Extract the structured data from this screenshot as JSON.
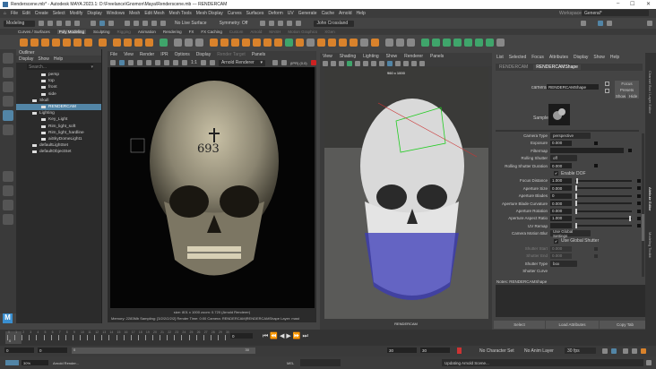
{
  "window": {
    "title": "Renderscene.mb* - Autodesk MAYA 2023.1: D:\\Freelance\\Gnomon\\Maya\\Renderscene.mb  ---  RENDERCAM",
    "minimize": "–",
    "maximize": "☐",
    "close": "✕"
  },
  "menubar": [
    "File",
    "Edit",
    "Create",
    "Select",
    "Modify",
    "Display",
    "Windows",
    "Mesh",
    "Edit Mesh",
    "Mesh Tools",
    "Mesh Display",
    "Curves",
    "Surfaces",
    "Deform",
    "UV",
    "Generate",
    "Cache",
    "Arnold",
    "Help"
  ],
  "workspace": {
    "label": "Workspace:",
    "value": "General*"
  },
  "statusline": {
    "mode": "Modeling",
    "live_surface": "No Live Surface",
    "symmetry": "Symmetry: Off",
    "user": "John Crossland"
  },
  "shelf_tabs": [
    "Curves / Surfaces",
    "Poly Modeling",
    "Sculpting",
    "Rigging",
    "Animation",
    "Rendering",
    "FX",
    "FX Caching",
    "Custom",
    "Arnold",
    "MASH",
    "Motion Graphics",
    "XGen"
  ],
  "shelf_active": "Poly Modeling",
  "outliner": {
    "title": "Outliner",
    "menu": [
      "Display",
      "Show",
      "Help"
    ],
    "search_placeholder": "Search...",
    "items": [
      {
        "label": "persp",
        "indent": 2
      },
      {
        "label": "top",
        "indent": 2
      },
      {
        "label": "front",
        "indent": 2
      },
      {
        "label": "side",
        "indent": 2
      },
      {
        "label": "Skull",
        "indent": 1
      },
      {
        "label": "RENDERCAM",
        "indent": 2,
        "selected": true
      },
      {
        "label": "Lighting",
        "indent": 1
      },
      {
        "label": "Key_Light",
        "indent": 2
      },
      {
        "label": "Rim_light_soft",
        "indent": 2
      },
      {
        "label": "Rim_light_hardline",
        "indent": 2
      },
      {
        "label": "aiSkyDomeLight1",
        "indent": 2
      },
      {
        "label": "defaultLightSet",
        "indent": 1
      },
      {
        "label": "defaultObjectSet",
        "indent": 1
      }
    ]
  },
  "renderview": {
    "menu": [
      "File",
      "View",
      "Render",
      "IPR",
      "Options",
      "Display",
      "Render Target",
      "Panels"
    ],
    "renderer": "Arnold Renderer",
    "ratio": "1:1",
    "ipr_label": "(IPR) (0.0)",
    "skull_text": "693",
    "size_line": "size: 801 x 1000  zoom: 0.720     (Arnold Renderer)",
    "stats_line": "Memory: 2283Mb   Sampling: [3/2/2/2/2/2]   Render Time: 0:00   Camera: RENDERCAM|RENDERCAMShape   Layer: mast"
  },
  "viewport": {
    "menu": [
      "View",
      "Shading",
      "Lighting",
      "Show",
      "Renderer",
      "Panels"
    ],
    "resolution": "960 x 1000",
    "camera_label": "RENDERCAM"
  },
  "attribute_editor": {
    "menu": [
      "List",
      "Selected",
      "Focus",
      "Attributes",
      "Display",
      "Show",
      "Help"
    ],
    "tabs": [
      "RENDERCAM",
      "RENDERCAMShape"
    ],
    "active_tab": "RENDERCAMShape",
    "camera_label": "camera:",
    "camera_value": "RENDERCAMShape",
    "buttons": {
      "focus": "Focus",
      "presets": "Presets",
      "show": "Show",
      "hide": "Hide"
    },
    "sample_label": "Sample",
    "attributes": [
      {
        "label": "Camera Type",
        "type": "dropdown",
        "value": "perspective"
      },
      {
        "label": "Exposure",
        "type": "field",
        "value": "0.000"
      },
      {
        "label": "Filtermap",
        "type": "wide",
        "value": ""
      },
      {
        "label": "Rolling Shutter",
        "type": "dropdown",
        "value": "off"
      },
      {
        "label": "Rolling Shutter Duration",
        "type": "field",
        "value": "0.000"
      },
      {
        "label": "Enable DOF",
        "type": "check",
        "value": "true"
      },
      {
        "label": "Focus Distance",
        "type": "slider",
        "value": "1.000",
        "fraction": 0.02
      },
      {
        "label": "Aperture Size",
        "type": "slider",
        "value": "0.000",
        "fraction": 0
      },
      {
        "label": "Aperture Blades",
        "type": "slider",
        "value": "0",
        "fraction": 0
      },
      {
        "label": "Aperture Blade Curvature",
        "type": "slider",
        "value": "0.000",
        "fraction": 0
      },
      {
        "label": "Aperture Rotation",
        "type": "slider",
        "value": "0.000",
        "fraction": 0
      },
      {
        "label": "Aperture Aspect Ratio",
        "type": "slider",
        "value": "1.000",
        "fraction": 1
      },
      {
        "label": "UV Remap",
        "type": "slider",
        "value": "",
        "fraction": 0
      },
      {
        "label": "Camera Motion Blur",
        "type": "dropdown",
        "value": "Use Global Settings"
      },
      {
        "label": "Use Global Shutter",
        "type": "check",
        "value": "true"
      },
      {
        "label": "Shutter Start",
        "type": "field",
        "value": "0.000",
        "disabled": true
      },
      {
        "label": "Shutter End",
        "type": "field",
        "value": "0.000",
        "disabled": true
      },
      {
        "label": "Shutter Type",
        "type": "dropdown",
        "value": "box"
      },
      {
        "label": "Shutter Curve",
        "type": "label",
        "value": ""
      }
    ],
    "notes_label": "Notes:  RENDERCAMShape",
    "bottom_buttons": [
      "Select",
      "Load Attributes",
      "Copy Tab"
    ]
  },
  "side_tabs": [
    "Channel Box / Layer Editor",
    "Attribute Editor",
    "Modeling Toolkit"
  ],
  "timeline": {
    "ticks": [
      "0",
      "1",
      "2",
      "3",
      "4",
      "5",
      "6",
      "7",
      "8",
      "9",
      "10",
      "11",
      "12",
      "13",
      "14",
      "15",
      "16",
      "17",
      "18",
      "19",
      "20",
      "21",
      "22",
      "23",
      "24",
      "25",
      "26",
      "27",
      "28",
      "29",
      "30"
    ],
    "current_frame": "0",
    "current_field": "0"
  },
  "range": {
    "start": "0",
    "anim_start": "0",
    "range_start_label": "0",
    "range_end_label": "30",
    "end": "30",
    "anim_end": "30",
    "character_set": "No Character Set",
    "anim_layer": "No Anim Layer",
    "fps": "30 fps"
  },
  "commandline": {
    "progress": "30%",
    "progress_fraction": 0.3,
    "task": "Arnold Render...",
    "lang": "MEL",
    "status": "Updating Arnold Scene..."
  },
  "colors": {
    "accent": "#5285a6",
    "shelf_orange": "#d9822b",
    "shelf_green": "#3fa56b",
    "outliner_bg": "#2b2b2b"
  }
}
